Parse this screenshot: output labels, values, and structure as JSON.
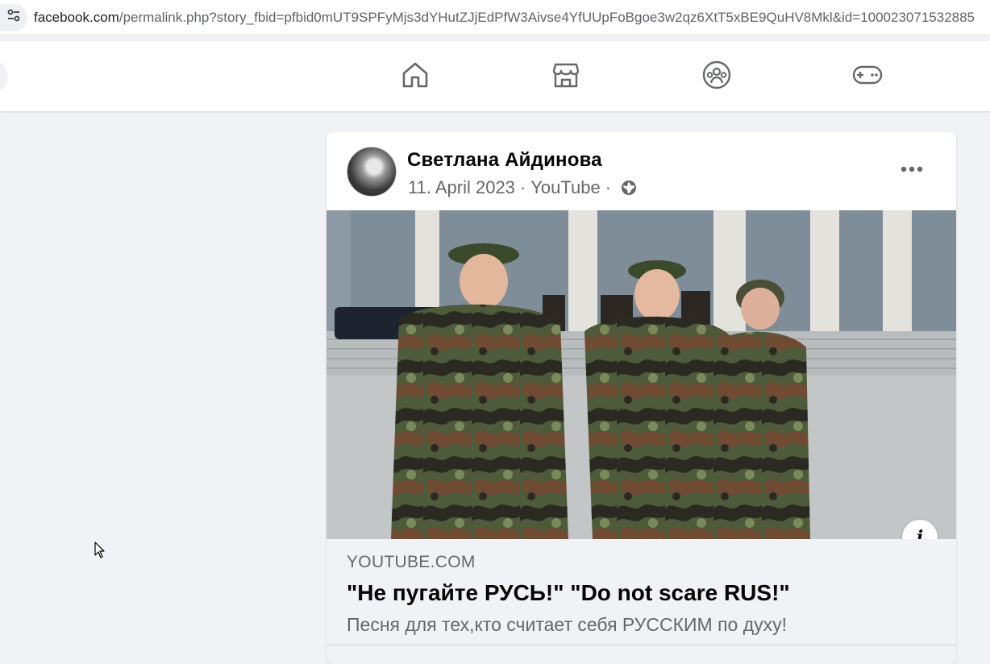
{
  "browser": {
    "url_host": "facebook.com",
    "url_rest": "/permalink.php?story_fbid=pfbid0mUT9SPFyMjs3dYHutZJjEdPfW3Aivse4YfUUpFoBgoe3w2qz6XtT5xBE9QuHV8Mkl&id=100023071532885",
    "site_info_icon": "tune-icon"
  },
  "nav": {
    "tabs": [
      {
        "name": "home",
        "icon": "home-icon"
      },
      {
        "name": "marketplace",
        "icon": "store-icon"
      },
      {
        "name": "groups",
        "icon": "groups-icon"
      },
      {
        "name": "gaming",
        "icon": "gamepad-icon"
      }
    ]
  },
  "post": {
    "author": "Светлана Айдинова",
    "date": "11. April 2023",
    "separator": "·",
    "source": "YouTube",
    "privacy_icon": "globe-icon",
    "menu_icon": "more-icon",
    "link": {
      "domain": "YOUTUBE.COM",
      "title": "\"Не пугайте РУСЬ!\" \"Do not scare RUS!\"",
      "description": "Песня для тех,кто считает себя РУССКИМ по духу!"
    },
    "info_button": "i"
  },
  "colors": {
    "page_bg": "#f0f2f5",
    "text_primary": "#050505",
    "text_secondary": "#65676b",
    "nav_icon": "#65676b"
  }
}
